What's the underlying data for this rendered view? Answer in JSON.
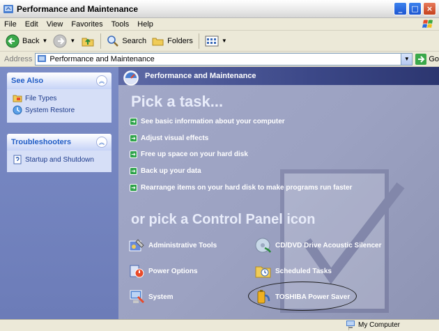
{
  "window": {
    "title": "Performance and Maintenance"
  },
  "menu": [
    "File",
    "Edit",
    "View",
    "Favorites",
    "Tools",
    "Help"
  ],
  "toolbar": {
    "back_label": "Back",
    "search_label": "Search",
    "folders_label": "Folders"
  },
  "address": {
    "label": "Address",
    "value": "Performance and Maintenance",
    "go_label": "Go"
  },
  "see_also": {
    "title": "See Also",
    "items": [
      {
        "label": "File Types"
      },
      {
        "label": "System Restore"
      }
    ]
  },
  "troubleshooters": {
    "title": "Troubleshooters",
    "items": [
      {
        "label": "Startup and Shutdown"
      }
    ]
  },
  "main": {
    "header": "Performance and Maintenance",
    "pick_task": "Pick a task...",
    "tasks": [
      "See basic information about your computer",
      "Adjust visual effects",
      "Free up space on your hard disk",
      "Back up your data",
      "Rearrange items on your hard disk to make programs run faster"
    ],
    "or_pick": "or pick a Control Panel icon",
    "icons": [
      "Administrative Tools",
      "CD/DVD Drive Acoustic Silencer",
      "Power Options",
      "Scheduled Tasks",
      "System",
      "TOSHIBA Power Saver"
    ]
  },
  "status": {
    "zone": "My Computer"
  },
  "colors": {
    "task_pane": "#6c7cb8",
    "content": "#9ca2c2",
    "header": "#3c4888",
    "task_arrow": "#2ea34a"
  }
}
